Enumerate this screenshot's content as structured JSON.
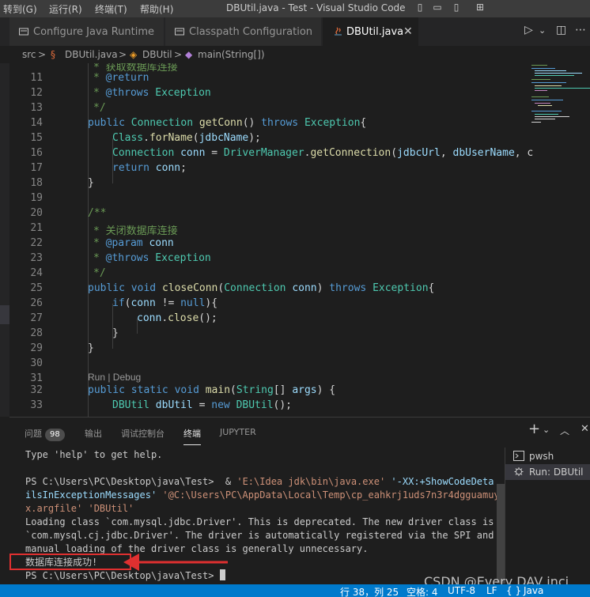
{
  "titlebar": {
    "menus": [
      "转到(G)",
      "运行(R)",
      "终端(T)",
      "帮助(H)"
    ],
    "window_title": "DBUtil.java - Test - Visual Studio Code"
  },
  "tabs": [
    {
      "label": "Configure Java Runtime",
      "icon": "java-runtime-icon"
    },
    {
      "label": "Classpath Configuration",
      "icon": "java-runtime-icon"
    },
    {
      "label": "DBUtil.java",
      "icon": "java-file-icon",
      "active": true
    }
  ],
  "breadcrumb": {
    "items": [
      "src",
      "DBUtil.java",
      "DBUtil",
      "main(String[])"
    ],
    "separator": ">"
  },
  "editor": {
    "line_numbers": [
      "11",
      "12",
      "13",
      "14",
      "15",
      "16",
      "17",
      "18",
      "19",
      "20",
      "21",
      "22",
      "23",
      "24",
      "25",
      "26",
      "27",
      "28",
      "29",
      "30",
      "31",
      "32",
      "33"
    ],
    "codelens": "Run | Debug",
    "top_partial": "* 获取数据库连接",
    "lines": {
      "l12": {
        "star": "* ",
        "tag": "@return"
      },
      "l13": {
        "star": "* ",
        "tag": "@throws",
        "type": " Exception"
      },
      "l14": "*/",
      "l15": {
        "kw1": "public ",
        "ty1": "Connection ",
        "fn": "getConn",
        "p": "() ",
        "kw2": "throws ",
        "ty2": "Exception",
        "end": "{"
      },
      "l16": {
        "ty": "Class",
        "dot": ".",
        "fn": "forName",
        "p1": "(",
        "vr": "jdbcName",
        "p2": ");"
      },
      "l17": {
        "ty1": "Connection ",
        "vr1": "conn",
        "eq": " = ",
        "ty2": "DriverManager",
        "dot": ".",
        "fn": "getConnection",
        "p1": "(",
        "vr2": "jdbcUrl",
        "c": ", ",
        "vr3": "dbUserName",
        "p2": ", c"
      },
      "l18": {
        "kw": "return ",
        "vr": "conn",
        "end": ";"
      },
      "l19": "}",
      "l21": "/**",
      "l22": "* 关闭数据库连接",
      "l23": {
        "star": "* ",
        "tag": "@param",
        "vr": " conn"
      },
      "l24": {
        "star": "* ",
        "tag": "@throws",
        "type": " Exception"
      },
      "l25": "*/",
      "l26": {
        "kw1": "public ",
        "kw2": "void ",
        "fn": "closeConn",
        "p1": "(",
        "ty": "Connection ",
        "vr": "conn",
        "p2": ") ",
        "kw3": "throws ",
        "ty2": "Exception",
        "end": "{"
      },
      "l27": {
        "kw": "if",
        "p1": "(",
        "vr": "conn",
        "op": " != ",
        "kw2": "null",
        "p2": "){"
      },
      "l28": {
        "vr": "conn",
        "dot": ".",
        "fn": "close",
        "p": "();"
      },
      "l29": "}",
      "l30": "}",
      "l32": {
        "kw1": "public ",
        "kw2": "static ",
        "kw3": "void ",
        "fn": "main",
        "p1": "(",
        "ty": "String",
        "p2": "[] ",
        "vr": "args",
        "p3": ") {"
      },
      "l33": {
        "ty1": "DBUtil ",
        "vr": "dbUtil",
        "eq": " = ",
        "kw": "new ",
        "ty2": "DBUtil",
        "p": "();"
      }
    }
  },
  "panel": {
    "tabs": [
      "问题",
      "输出",
      "调试控制台",
      "终端",
      "JUPYTER"
    ],
    "problems_count": "98",
    "active_tab": "终端",
    "terminal": {
      "l1": "Type 'help' to get help.",
      "prompt1": "PS C:\\Users\\PC\\Desktop\\java\\Test>",
      "amp": "&",
      "cmd_exe": "'E:\\Idea jdk\\bin\\java.exe'",
      "cmd_args1": "'-XX:+ShowCodeDeta",
      "cmd_args2": "ilsInExceptionMessages'",
      "cmd_file1": "'@C:\\Users\\PC\\AppData\\Local\\Temp\\cp_eahkrj1uds7n3r4dgguamuyn",
      "cmd_file2": "x.argfile'",
      "cmd_class": "'DBUtil'",
      "out1": "Loading class `com.mysql.jdbc.Driver'. This is deprecated. The new driver class is",
      "out2": "`com.mysql.cj.jdbc.Driver'. The driver is automatically registered via the SPI and",
      "out3": "manual loading of the driver class is generally unnecessary.",
      "out4": "数据库连接成功!",
      "prompt2": "PS C:\\Users\\PC\\Desktop\\java\\Test>"
    },
    "terminal_list": [
      "pwsh",
      "Run: DBUtil"
    ]
  },
  "watermark": "CSDN @Every DAV inci",
  "statusbar": {
    "position": "行 38，列 25",
    "spaces": "空格: 4",
    "encoding": "UTF-8",
    "eol": "LF",
    "braces": "{ }",
    "language": "Java"
  },
  "colors": {
    "status_bar": "#007acc",
    "annotation": "#e03030",
    "editor_bg": "#1e1e1e"
  }
}
